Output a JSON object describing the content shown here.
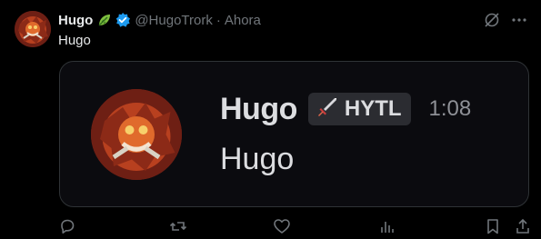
{
  "author": {
    "name": "Hugo",
    "handle": "@HugoTrork",
    "separator": "·",
    "time": "Ahora"
  },
  "tweet": {
    "text": "Hugo"
  },
  "card": {
    "name": "Hugo",
    "tag": "HYTL",
    "time": "1:08",
    "message": "Hugo"
  },
  "icons": {
    "leaf": "leaf-icon",
    "verified": "verified-badge-icon",
    "grok": "grok-icon",
    "more": "more-icon",
    "reply": "reply-icon",
    "retweet": "retweet-icon",
    "like": "like-icon",
    "views": "views-icon",
    "bookmark": "bookmark-icon",
    "share": "share-icon",
    "sword": "sword-icon"
  },
  "colors": {
    "background": "#000000",
    "text": "#e7e9ea",
    "muted": "#71767b",
    "verified": "#1d9bf0",
    "card_bg": "#0b0b0f",
    "card_border": "#2f3336",
    "tag_bg": "#2b2c31"
  }
}
